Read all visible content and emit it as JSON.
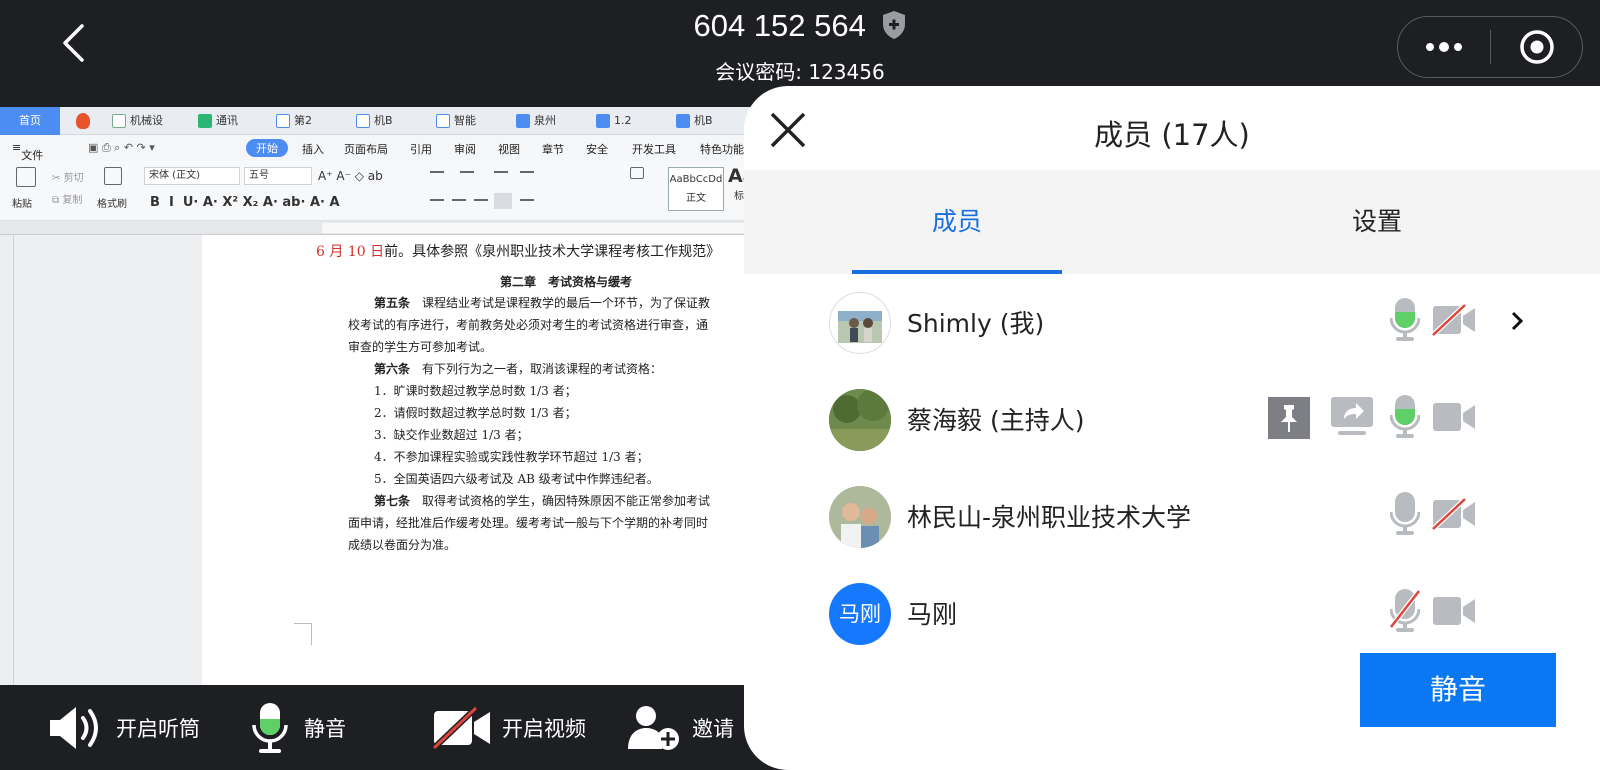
{
  "header": {
    "meeting_id": "604 152 564",
    "password_text": "会议密码: 123456"
  },
  "doc": {
    "tabs": [
      "首页",
      "机械设",
      "通讯",
      "第2",
      "机B",
      "智能",
      "泉州",
      "1.2",
      "机B"
    ],
    "menu": [
      "文件",
      "开始",
      "插入",
      "页面布局",
      "引用",
      "审阅",
      "视图",
      "章节",
      "安全",
      "开发工具",
      "特色功能"
    ],
    "ribbon": {
      "paste": "粘贴",
      "cut": "剪切",
      "copy": "复制",
      "format_painter": "格式刷",
      "font": "宋体 (正文)",
      "size": "五号",
      "style_sample": "AaBbCcDd",
      "style_normal": "正文",
      "style_heading_sample": "AaI",
      "style_heading": "标题"
    },
    "lines": [
      {
        "red": "6 月 10 日",
        "text": "前。具体参照《泉州职业技术大学课程考核工作规范》"
      },
      {
        "text": "第二章　考试资格与缓考"
      },
      {
        "bold": "第五条",
        "text": "　课程结业考试是课程教学的最后一个环节，为了保证教"
      },
      {
        "text": "校考试的有序进行，考前教务处必须对考生的考试资格进行审查，通"
      },
      {
        "text": "审查的学生方可参加考试。"
      },
      {
        "bold": "第六条",
        "text": "　有下列行为之一者，取消该课程的考试资格："
      },
      {
        "text": "1．旷课时数超过教学总时数 1/3 者；"
      },
      {
        "text": "2．请假时数超过教学总时数 1/3 者；"
      },
      {
        "text": "3．缺交作业数超过 1/3 者；"
      },
      {
        "text": "4．不参加课程实验或实践性教学环节超过 1/3 者；"
      },
      {
        "text": "5．全国英语四六级考试及 AB 级考试中作弊违纪者。"
      },
      {
        "bold": "第七条",
        "text": "　取得考试资格的学生，确因特殊原因不能正常参加考试"
      },
      {
        "text": "面申请，经批准后作缓考处理。缓考考试一般与下个学期的补考同时"
      },
      {
        "text": "成绩以卷面分为准。"
      }
    ]
  },
  "toolbar": {
    "speaker": "开启听筒",
    "mute": "静音",
    "video": "开启视频",
    "invite": "邀请"
  },
  "panel": {
    "title": "成员 (17人)",
    "tab_members": "成员",
    "tab_settings": "设置",
    "members": [
      {
        "name": "Shimly (我)",
        "mic": "on",
        "camera": "off"
      },
      {
        "name": "蔡海毅 (主持人)",
        "mic": "on",
        "camera": "on",
        "pinned": true,
        "sharing": true
      },
      {
        "name": "林民山-泉州职业技术大学",
        "mic": "idle",
        "camera": "off"
      },
      {
        "name": "马刚",
        "avatar_text": "马刚",
        "mic": "muted",
        "camera": "on"
      }
    ],
    "mute_all": "静音"
  },
  "colors": {
    "accent": "#1a6fe0",
    "button": "#0a78f5",
    "mic_active": "#5fd068",
    "muted_red": "#e0443a",
    "bar_bg": "#1e1f22"
  }
}
